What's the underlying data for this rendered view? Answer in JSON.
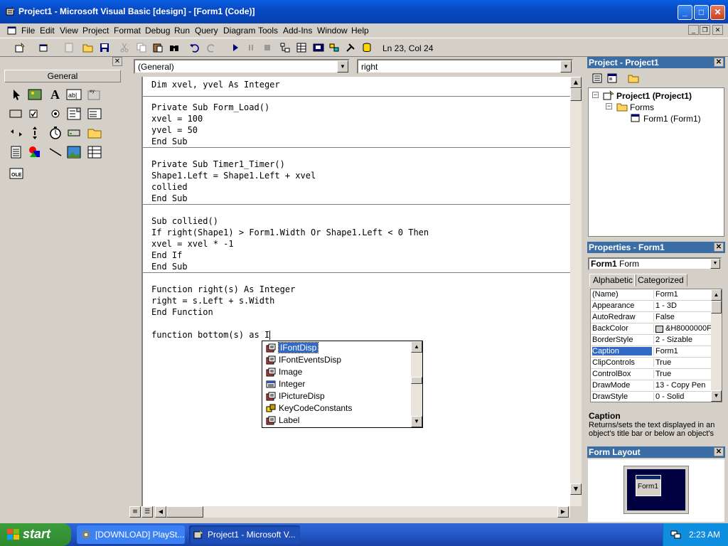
{
  "window": {
    "title": "Project1 - Microsoft Visual Basic [design] - [Form1 (Code)]"
  },
  "menu": [
    "File",
    "Edit",
    "View",
    "Project",
    "Format",
    "Debug",
    "Run",
    "Query",
    "Diagram",
    "Tools",
    "Add-Ins",
    "Window",
    "Help"
  ],
  "toolbar": {
    "position": "Ln 23, Col 24"
  },
  "toolbox": {
    "tab": "General"
  },
  "code_window": {
    "object_combo": "(General)",
    "proc_combo": "right",
    "lines": [
      "Dim xvel, yvel As Integer",
      "",
      "Private Sub Form_Load()",
      "xvel = 100",
      "yvel = 50",
      "End Sub",
      "",
      "Private Sub Timer1_Timer()",
      "Shape1.Left = Shape1.Left + xvel",
      "collied",
      "End Sub",
      "",
      "Sub collied()",
      "If right(Shape1) > Form1.Width Or Shape1.Left < 0 Then",
      "xvel = xvel * -1",
      "End If",
      "End Sub",
      "",
      "Function right(s) As Integer",
      "right = s.Left + s.Width",
      "End Function",
      "",
      "function bottom(s) as I"
    ]
  },
  "autocomplete": {
    "items": [
      "IFontDisp",
      "IFontEventsDisp",
      "Image",
      "Integer",
      "IPictureDisp",
      "KeyCodeConstants",
      "Label"
    ],
    "selected": 0
  },
  "project": {
    "title": "Project - Project1",
    "root": "Project1 (Project1)",
    "folder": "Forms",
    "form": "Form1 (Form1)"
  },
  "properties": {
    "title": "Properties - Form1",
    "object_name": "Form1",
    "object_type": "Form",
    "tabs": [
      "Alphabetic",
      "Categorized"
    ],
    "rows": [
      {
        "name": "(Name)",
        "value": "Form1"
      },
      {
        "name": "Appearance",
        "value": "1 - 3D"
      },
      {
        "name": "AutoRedraw",
        "value": "False"
      },
      {
        "name": "BackColor",
        "value": "&H8000000F"
      },
      {
        "name": "BorderStyle",
        "value": "2 - Sizable"
      },
      {
        "name": "Caption",
        "value": "Form1"
      },
      {
        "name": "ClipControls",
        "value": "True"
      },
      {
        "name": "ControlBox",
        "value": "True"
      },
      {
        "name": "DrawMode",
        "value": "13 - Copy Pen"
      },
      {
        "name": "DrawStyle",
        "value": "0 - Solid"
      }
    ],
    "selected_row": 5,
    "desc_title": "Caption",
    "desc_text": "Returns/sets the text displayed in an object's title bar or below an object's"
  },
  "form_layout": {
    "title": "Form Layout",
    "form_label": "Form1"
  },
  "taskbar": {
    "start": "start",
    "tasks": [
      "[DOWNLOAD] PlaySt...",
      "Project1 - Microsoft V..."
    ],
    "clock": "2:23 AM"
  },
  "colors": {
    "title_blue": "#0a5fe3",
    "selection": "#316ac5",
    "taskbar": "#2457c6"
  }
}
